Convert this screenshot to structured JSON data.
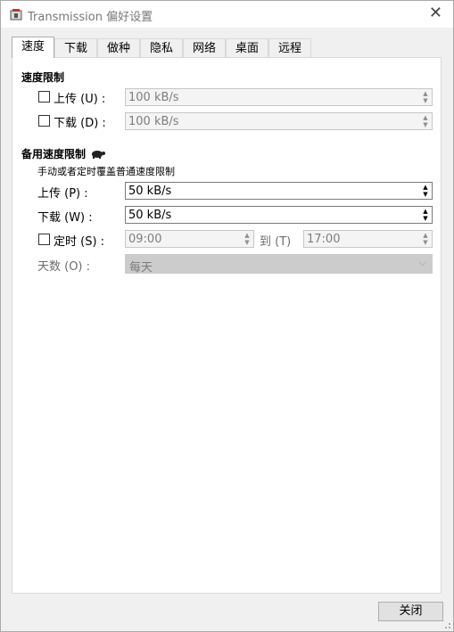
{
  "window": {
    "title": "Transmission 偏好设置"
  },
  "tabs": [
    {
      "label": "速度"
    },
    {
      "label": "下载"
    },
    {
      "label": "做种"
    },
    {
      "label": "隐私"
    },
    {
      "label": "网络"
    },
    {
      "label": "桌面"
    },
    {
      "label": "远程"
    }
  ],
  "active_tab": "速度",
  "speed_limits": {
    "title": "速度限制",
    "upload": {
      "label": "上传 (U) :",
      "value": "100 kB/s",
      "checked": false
    },
    "download": {
      "label": "下载 (D) :",
      "value": "100 kB/s",
      "checked": false
    }
  },
  "alt_speed": {
    "title": "备用速度限制",
    "icon": "turtle-icon",
    "description": "手动或者定时覆盖普通速度限制",
    "upload": {
      "label": "上传 (P) :",
      "value": "50 kB/s"
    },
    "download": {
      "label": "下载 (W) :",
      "value": "50 kB/s"
    },
    "schedule": {
      "label": "定时 (S) :",
      "checked": false,
      "from": "09:00",
      "to_label": "到 (T)",
      "to": "17:00"
    },
    "days": {
      "label": "天数 (O) :",
      "value": "每天"
    }
  },
  "footer": {
    "close_label": "关闭"
  }
}
